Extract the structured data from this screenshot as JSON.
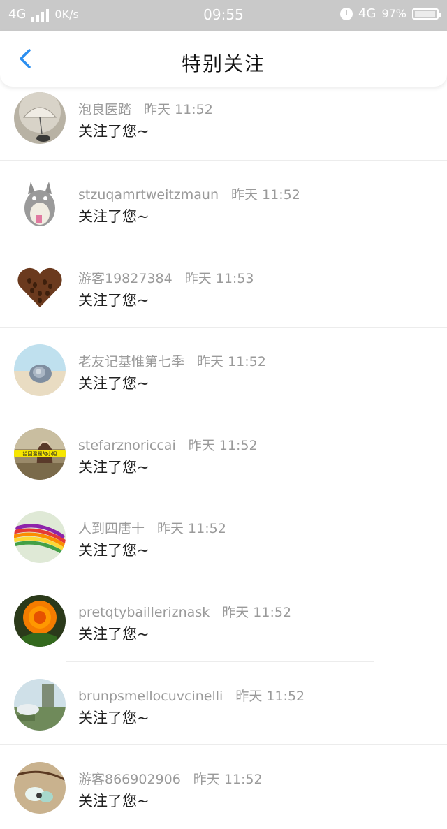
{
  "status_bar": {
    "network": "4G",
    "speed": "0K/s",
    "time": "09:55",
    "network_right": "4G",
    "battery": "97%",
    "battery_level": 0.97
  },
  "nav": {
    "title": "特别关注",
    "back_icon": "chevron-left-icon",
    "accent_color": "#2b8ef0"
  },
  "items": [
    {
      "name": "泡良医踏",
      "time": "昨天 11:52",
      "action": "关注了您~",
      "avatar": "umbrella-photo"
    },
    {
      "name": "stzuqamrtweitzmaun",
      "time": "昨天 11:52",
      "action": "关注了您~",
      "avatar": "totoro-illustration"
    },
    {
      "name": "游客19827384",
      "time": "昨天 11:53",
      "action": "关注了您~",
      "avatar": "coffee-heart-photo"
    },
    {
      "name": "老友记基惟第七季",
      "time": "昨天 11:52",
      "action": "关注了您~",
      "avatar": "shell-photo"
    },
    {
      "name": "stefarznoriccai",
      "time": "昨天 11:52",
      "action": "关注了您~",
      "avatar": "girl-photo",
      "avatar_caption": "拾回温暖的小姐"
    },
    {
      "name": "人到四唐十",
      "time": "昨天 11:52",
      "action": "关注了您~",
      "avatar": "rainbow-ribbons-photo"
    },
    {
      "name": "pretqtybailleriznask",
      "time": "昨天 11:52",
      "action": "关注了您~",
      "avatar": "orange-rose-photo"
    },
    {
      "name": "brunpsmellocuvcinelli",
      "time": "昨天 11:52",
      "action": "关注了您~",
      "avatar": "ruins-landscape-photo"
    },
    {
      "name": "游客866902906",
      "time": "昨天 11:52",
      "action": "关注了您~",
      "avatar": "flower-pendant-photo"
    }
  ]
}
